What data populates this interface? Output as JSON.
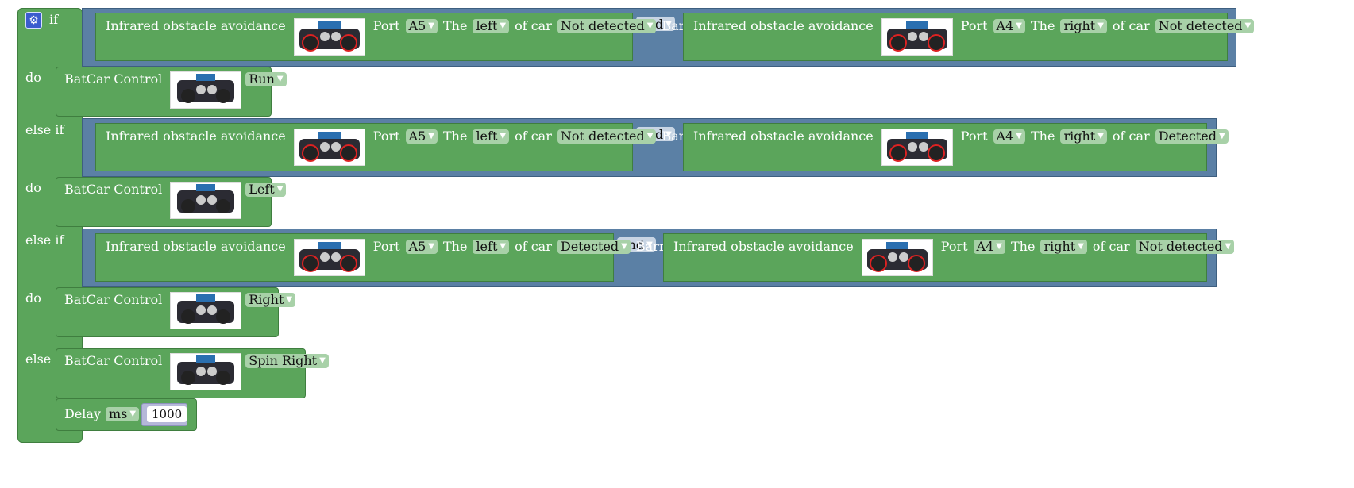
{
  "blocks": {
    "if_label": "if",
    "do_label": "do",
    "else_if_label": "else if",
    "else_label": "else",
    "gear_icon": "gear-icon",
    "sensor_label": "Infrared obstacle avoidance",
    "port_label": "Port",
    "the_label": "The",
    "ofcar_label": "of car",
    "barrier_label": "Barrier",
    "control_label": "BatCar Control",
    "delay_label": "Delay",
    "conditions": [
      {
        "op": "and",
        "left": {
          "port": "A5",
          "side": "left",
          "state": "Not detected"
        },
        "right": {
          "port": "A4",
          "side": "right",
          "state": "Not detected"
        }
      },
      {
        "op": "and",
        "left": {
          "port": "A5",
          "side": "left",
          "state": "Not detected"
        },
        "right": {
          "port": "A4",
          "side": "right",
          "state": "Detected"
        }
      },
      {
        "op": "and",
        "left": {
          "port": "A5",
          "side": "left",
          "state": "Detected"
        },
        "right": {
          "port": "A4",
          "side": "right",
          "state": "Not detected"
        }
      }
    ],
    "actions": [
      "Run",
      "Left",
      "Right",
      "Spin Right"
    ],
    "delay": {
      "unit": "ms",
      "value": "1000"
    }
  },
  "colors": {
    "logic": "#5b80a5",
    "green": "#5ba55b",
    "math": "#b5b8d9"
  }
}
